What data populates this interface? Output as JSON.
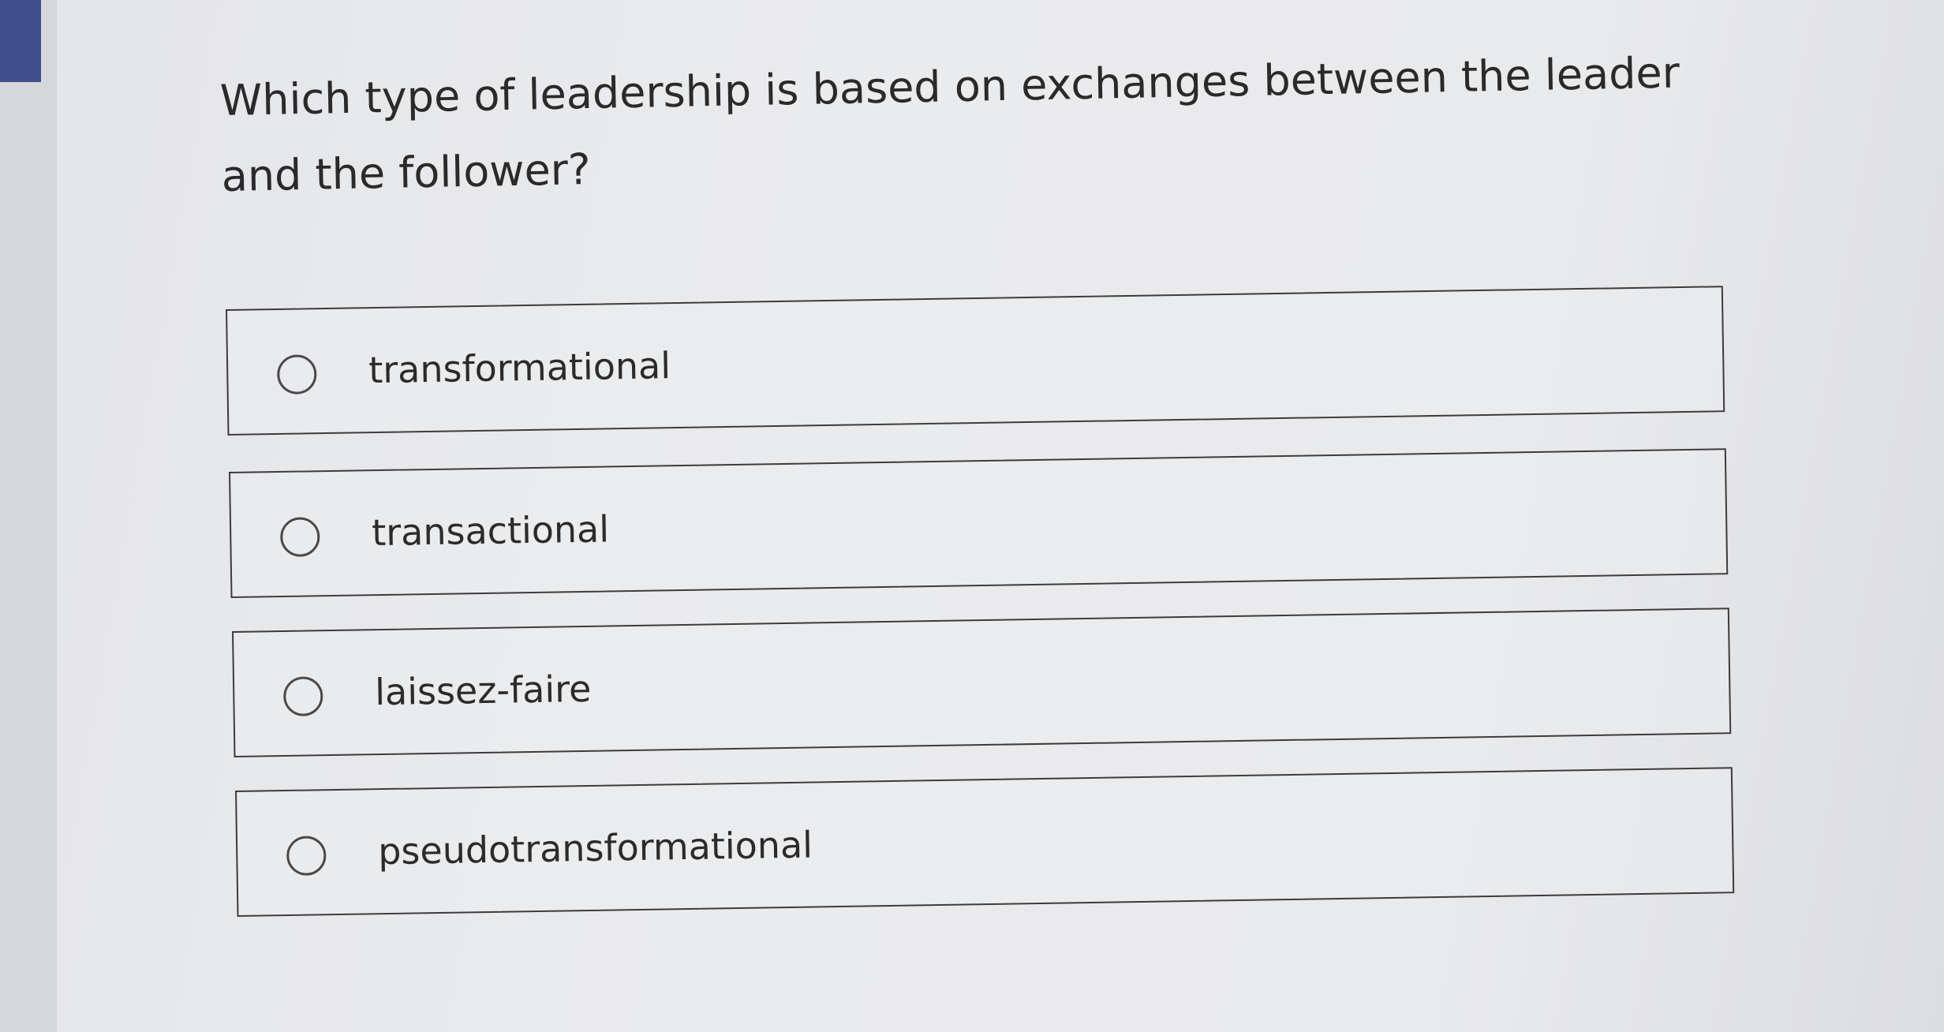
{
  "question": {
    "text": "Which type of leadership is based on exchanges between the leader and the follower?"
  },
  "options": [
    {
      "label": "transformational",
      "selected": false
    },
    {
      "label": "transactional",
      "selected": false
    },
    {
      "label": "laissez-faire",
      "selected": false
    },
    {
      "label": "pseudotransformational",
      "selected": false
    }
  ],
  "colors": {
    "accent": "#3f4f8c",
    "background": "#e8e9eb",
    "border": "#3c3c3c",
    "text": "#2b2b2b"
  }
}
